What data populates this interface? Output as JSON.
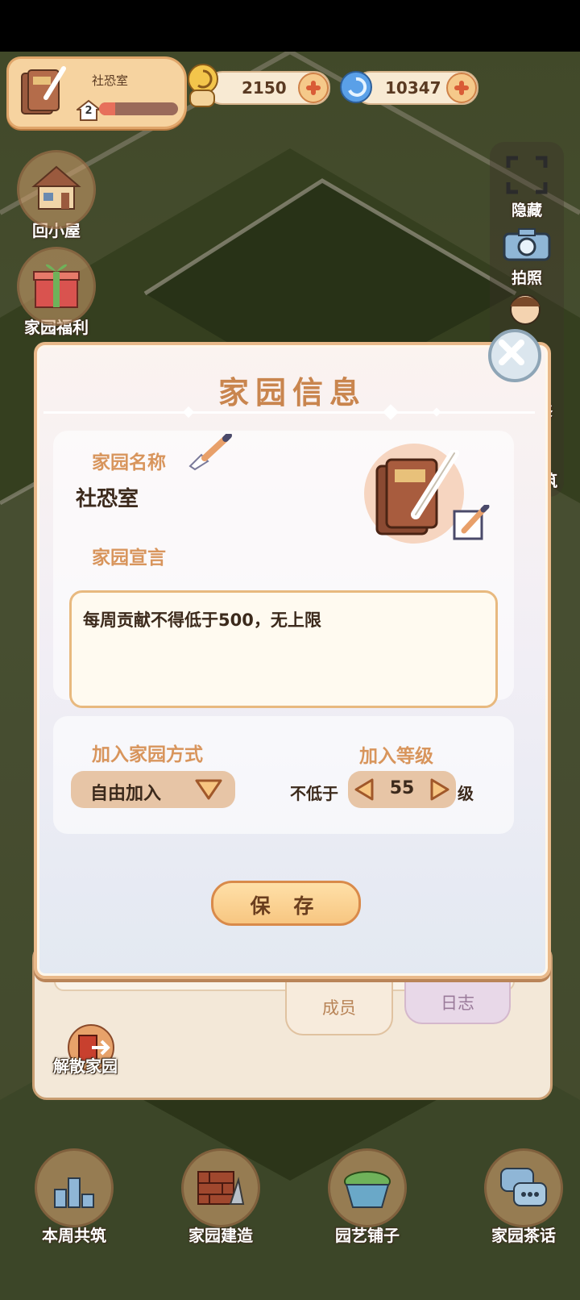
{
  "home": {
    "name": "社恐室",
    "level": "2",
    "progress": 0.2
  },
  "currency": {
    "coins": "2150",
    "gems": "10347"
  },
  "left_buttons": {
    "home": "回小屋",
    "welfare": "家园福利"
  },
  "right_buttons": {
    "hide": "隐藏",
    "photo": "拍照",
    "decorate": "修",
    "build": "筑"
  },
  "dialog": {
    "title": "家园信息",
    "name_label": "家园名称",
    "name_value": "社恐室",
    "motto_label": "家园宣言",
    "motto_value": "每周贡献不得低于500，无上限",
    "join_method_label": "加入家园方式",
    "join_method_value": "自由加入",
    "join_level_label": "加入等级",
    "min_prefix": "不低于",
    "min_level": "55",
    "level_suffix": "级",
    "save_label": "保 存"
  },
  "back_panel": {
    "tab_members": "成员",
    "tab_log": "日志",
    "disband": "解散家园"
  },
  "bottom_nav": {
    "weekly": "本周共筑",
    "build": "家园建造",
    "shop": "园艺铺子",
    "chat": "家园茶话"
  },
  "colors": {
    "accent": "#c9854e",
    "label": "#d8955c",
    "button": "#f7c681"
  }
}
